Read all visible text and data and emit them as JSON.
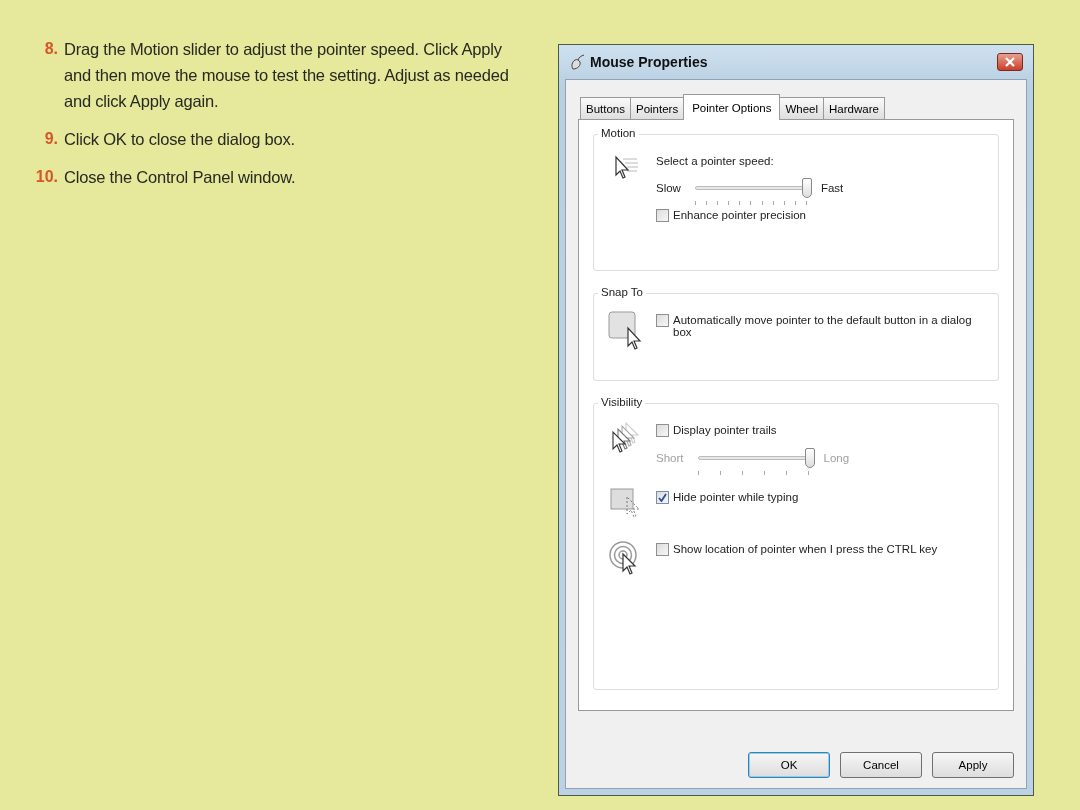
{
  "steps": [
    {
      "number": "8.",
      "text": "Drag the Motion slider to adjust the pointer speed. Click Apply and then move the mouse to test the setting. Adjust as needed and click Apply again."
    },
    {
      "number": "9.",
      "text": "Click OK to close the dialog box."
    },
    {
      "number": "10.",
      "text": "Close the Control Panel window."
    }
  ],
  "dialog": {
    "title": "Mouse Properties",
    "tabs": [
      {
        "label": "Buttons",
        "selected": false
      },
      {
        "label": "Pointers",
        "selected": false
      },
      {
        "label": "Pointer Options",
        "selected": true
      },
      {
        "label": "Wheel",
        "selected": false
      },
      {
        "label": "Hardware",
        "selected": false
      }
    ],
    "groups": [
      {
        "title": "Motion",
        "rows": [
          [
            {
              "kind": "label",
              "text": "Select a pointer speed:"
            },
            {
              "kind": "slider",
              "min_label": "Slow",
              "max_label": "Fast",
              "level": 1.0,
              "disabled": false
            },
            {
              "kind": "checkbox",
              "label": "Enhance pointer precision",
              "checked": false
            }
          ]
        ]
      },
      {
        "title": "Snap To",
        "rows": [
          [
            {
              "kind": "checkbox",
              "label": "Automatically move pointer to the default button in a dialog box",
              "checked": false
            }
          ]
        ]
      },
      {
        "title": "Visibility",
        "rows": [
          [
            {
              "kind": "checkbox",
              "label": "Display pointer trails",
              "checked": false
            },
            {
              "kind": "slider",
              "min_label": "Short",
              "max_label": "Long",
              "level": 1.0,
              "disabled": true
            }
          ],
          [
            {
              "kind": "checkbox",
              "label": "Hide pointer while typing",
              "checked": true
            }
          ],
          [
            {
              "kind": "checkbox",
              "label": "Show location of pointer when I press the CTRL key",
              "checked": false
            }
          ]
        ]
      }
    ],
    "buttons": [
      {
        "label": "OK",
        "default": true
      },
      {
        "label": "Cancel",
        "default": false
      },
      {
        "label": "Apply",
        "default": false
      }
    ]
  }
}
